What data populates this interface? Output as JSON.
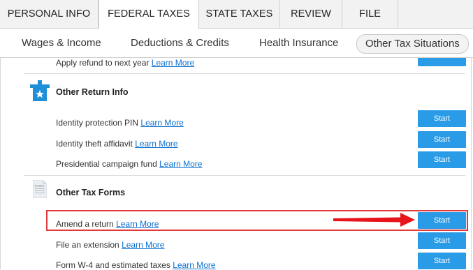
{
  "tabs": [
    "PERSONAL INFO",
    "FEDERAL TAXES",
    "STATE TAXES",
    "REVIEW",
    "FILE"
  ],
  "subnav": [
    "Wages & Income",
    "Deductions & Credits",
    "Health Insurance",
    "Other Tax Situations"
  ],
  "top_row": {
    "label": "Apply refund to next year",
    "link": "Learn More"
  },
  "sections": [
    {
      "title": "Other Return Info",
      "rows": [
        {
          "label": "Identity protection PIN",
          "link": "Learn More",
          "button": "Start"
        },
        {
          "label": "Identity theft affidavit",
          "link": "Learn More",
          "button": "Start"
        },
        {
          "label": "Presidential campaign fund",
          "link": "Learn More",
          "button": "Start"
        }
      ]
    },
    {
      "title": "Other Tax Forms",
      "icon_text": "TAXES",
      "rows": [
        {
          "label": "Amend a return",
          "link": "Learn More",
          "button": "Start"
        },
        {
          "label": "File an extension",
          "link": "Learn More",
          "button": "Start"
        },
        {
          "label": "Form W-4 and estimated taxes",
          "link": "Learn More",
          "button": "Start"
        }
      ]
    }
  ],
  "colors": {
    "accent": "#2a9be6",
    "highlight": "#e23a3a",
    "link": "#0b6fcf"
  }
}
